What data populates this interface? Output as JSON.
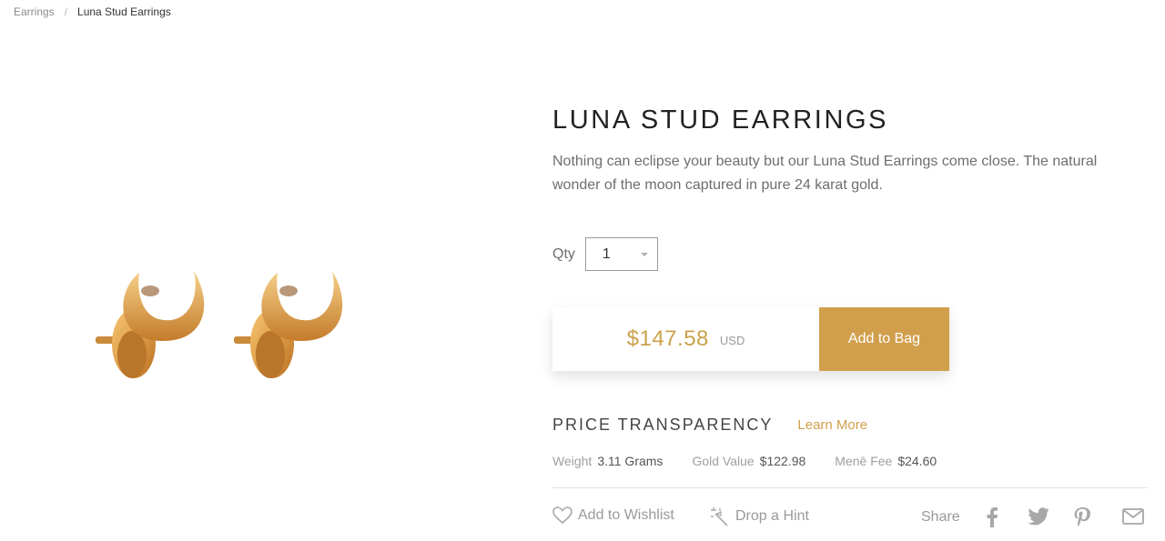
{
  "breadcrumb": {
    "parent": "Earrings",
    "separator": "/",
    "current": "Luna Stud Earrings"
  },
  "product": {
    "title": "LUNA STUD EARRINGS",
    "description": "Nothing can eclipse your beauty but our Luna Stud Earrings come close. The natural wonder of the moon captured in pure 24 karat gold.",
    "image_icon": "gold-crescent-stud-earrings"
  },
  "quantity": {
    "label": "Qty",
    "value": "1"
  },
  "purchase": {
    "price": "$147.58",
    "currency": "USD",
    "add_to_bag_label": "Add to Bag"
  },
  "transparency": {
    "title": "PRICE TRANSPARENCY",
    "learn_more": "Learn More",
    "weight_label": "Weight",
    "weight_value": "3.11 Grams",
    "gold_value_label": "Gold Value",
    "gold_value": "$122.98",
    "fee_label": "Menē Fee",
    "fee_value": "$24.60"
  },
  "actions": {
    "wishlist_label": "Add to Wishlist",
    "hint_label": "Drop a Hint",
    "share_label": "Share",
    "social_icons": [
      "facebook-icon",
      "twitter-icon",
      "pinterest-icon",
      "email-icon"
    ]
  },
  "colors": {
    "accent": "#d19f4c",
    "price": "#c9a14a",
    "muted_text": "#9a9a9a"
  }
}
